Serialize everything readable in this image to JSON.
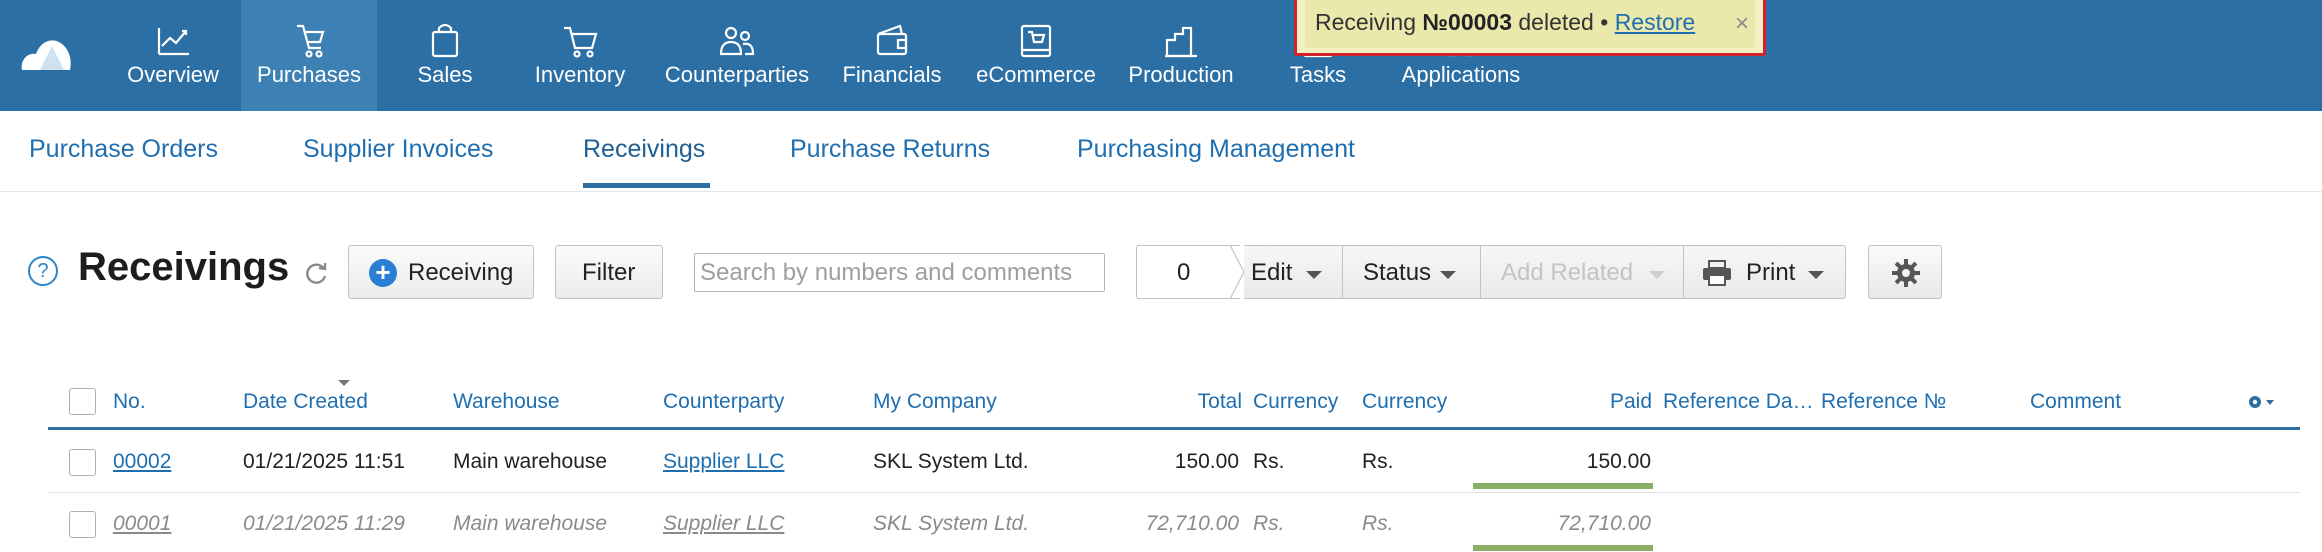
{
  "nav": {
    "items": [
      {
        "label": "Overview",
        "icon": "chart-line-icon"
      },
      {
        "label": "Purchases",
        "icon": "shopping-bag-icon",
        "active": true
      },
      {
        "label": "Sales",
        "icon": "bag-icon"
      },
      {
        "label": "Inventory",
        "icon": "cart-icon"
      },
      {
        "label": "Counterparties",
        "icon": "people-icon"
      },
      {
        "label": "Financials",
        "icon": "wallet-icon"
      },
      {
        "label": "eCommerce",
        "icon": "store-icon"
      },
      {
        "label": "Production",
        "icon": "factory-icon"
      },
      {
        "label": "Tasks",
        "icon": "checklist-icon"
      },
      {
        "label": "Applications",
        "icon": "apps-icon"
      }
    ]
  },
  "toast": {
    "prefix": "Receiving ",
    "number": "№00003",
    "suffix": " deleted • ",
    "restore_label": "Restore",
    "close_glyph": "×"
  },
  "subtabs": [
    {
      "label": "Purchase Orders"
    },
    {
      "label": "Supplier Invoices"
    },
    {
      "label": "Receivings",
      "active": true
    },
    {
      "label": "Purchase Returns"
    },
    {
      "label": "Purchasing Management"
    }
  ],
  "toolbar": {
    "help_glyph": "?",
    "title": "Receivings",
    "add_label": "Receiving",
    "filter_label": "Filter",
    "search_placeholder": "Search by numbers and comments",
    "selected_count": "0",
    "edit_label": "Edit",
    "status_label": "Status",
    "add_related_label": "Add Related",
    "print_label": "Print"
  },
  "table": {
    "columns": [
      "No.",
      "Date Created",
      "Warehouse",
      "Counterparty",
      "My Company",
      "Total",
      "Currency",
      "Currency",
      "Paid",
      "Reference Da…",
      "Reference №",
      "Comment"
    ],
    "rows": [
      {
        "no": "00002",
        "date": "01/21/2025 11:51",
        "warehouse": "Main warehouse",
        "counterparty": "Supplier LLC",
        "company": "SKL System Ltd.",
        "total": "150.00",
        "currency1": "Rs.",
        "currency2": "Rs.",
        "paid": "150.00",
        "paid_fraction": 1.0
      },
      {
        "no": "00001",
        "date": "01/21/2025 11:29",
        "warehouse": "Main warehouse",
        "counterparty": "Supplier LLC",
        "company": "SKL System Ltd.",
        "total": "72,710.00",
        "currency1": "Rs.",
        "currency2": "Rs.",
        "paid": "72,710.00",
        "paid_fraction": 1.0
      }
    ]
  },
  "colors": {
    "nav_bg": "#2c6fa4",
    "accent": "#1f6fb0",
    "paid_bar": "#8bae67",
    "toast_border": "#d1222c"
  }
}
